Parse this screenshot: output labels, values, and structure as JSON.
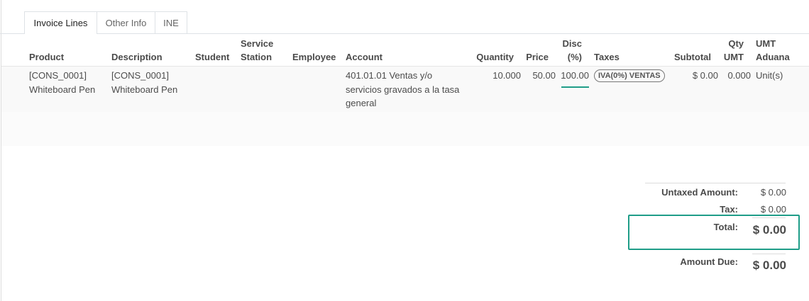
{
  "tabs": [
    {
      "label": "Invoice Lines"
    },
    {
      "label": "Other Info"
    },
    {
      "label": "INE"
    }
  ],
  "columns": {
    "product": "Product",
    "description": "Description",
    "student": "Student",
    "service_line1": "Service",
    "service_line2": "Station",
    "employee": "Employee",
    "account": "Account",
    "quantity": "Quantity",
    "price": "Price",
    "disc_line1": "Disc",
    "disc_line2": "(%)",
    "taxes": "Taxes",
    "subtotal": "Subtotal",
    "qty_umt_line1": "Qty",
    "qty_umt_line2": "UMT",
    "umt_aduana_line1": "UMT",
    "umt_aduana_line2": "Aduana"
  },
  "rows": [
    {
      "product_line1": "[CONS_0001]",
      "product_line2": "Whiteboard Pen",
      "description_line1": "[CONS_0001]",
      "description_line2": "Whiteboard Pen",
      "account_line1": "401.01.01 Ventas y/o",
      "account_line2": "servicios gravados a la tasa",
      "account_line3": "general",
      "quantity": "10.000",
      "price": "50.00",
      "discount": "100.00",
      "tax_badge": "IVA(0%) VENTAS",
      "subtotal": "$ 0.00",
      "qty_umt": "0.000",
      "umt_aduana": "Unit(s)"
    }
  ],
  "totals": {
    "untaxed_label": "Untaxed Amount:",
    "untaxed_value": "$ 0.00",
    "tax_label": "Tax:",
    "tax_value": "$ 0.00",
    "total_label": "Total:",
    "total_value": "$ 0.00",
    "amount_due_label": "Amount Due:",
    "amount_due_value": "$ 0.00"
  },
  "colors": {
    "accent": "#1f9d88"
  }
}
